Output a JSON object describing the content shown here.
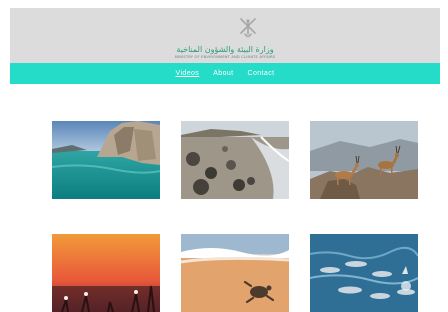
{
  "header": {
    "ministry_name_ar": "وزارة البيئة والشؤون المناخية",
    "ministry_name_en": "MINISTRY OF ENVIRONMENT AND CLIMATE AFFAIRS",
    "emblem_icon": "oman-khanjar-emblem-icon",
    "background": "#dcdcdc"
  },
  "nav": {
    "background": "#25dcc9",
    "items": [
      {
        "label": "Videos",
        "active": true
      },
      {
        "label": "About",
        "active": false
      },
      {
        "label": "Contact",
        "active": false
      }
    ]
  },
  "gallery": {
    "items": [
      {
        "subject": "coastal-cliffs-turquoise-water"
      },
      {
        "subject": "rocky-beach-shoreline"
      },
      {
        "subject": "arabian-gazelles-on-rocks"
      },
      {
        "subject": "sunset-sky-silhouettes"
      },
      {
        "subject": "sea-turtle-hatchling-on-sand"
      },
      {
        "subject": "dolphins-pod-swimming"
      }
    ]
  }
}
